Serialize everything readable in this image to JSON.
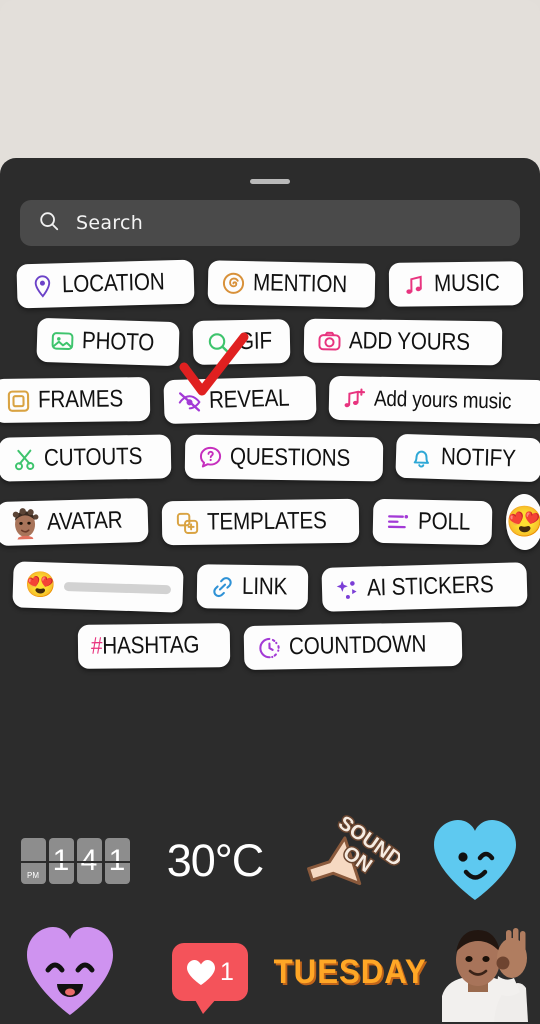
{
  "app": {
    "name": "Instagram Stories sticker tray"
  },
  "search": {
    "placeholder": "Search",
    "value": "",
    "icon": "search-icon"
  },
  "tray": {
    "grabber": "drag-handle",
    "rows": [
      {
        "items": [
          {
            "label": "LOCATION",
            "icon": "location-pin-icon",
            "color": "#6b42c8",
            "style": "caps",
            "rot": "r-1"
          },
          {
            "label": "MENTION",
            "icon": "threads-at-icon",
            "color": "#d8913a",
            "style": "caps",
            "rot": "r-2"
          },
          {
            "label": "MUSIC",
            "icon": "music-note-icon",
            "color": "#e8347f",
            "style": "caps",
            "rot": "r-3"
          }
        ]
      },
      {
        "items": [
          {
            "label": "PHOTO",
            "icon": "photo-image-icon",
            "color": "#3ec46d",
            "style": "caps",
            "rot": "r-4"
          },
          {
            "label": "GIF",
            "icon": "gif-search-icon",
            "color": "#3ec46d",
            "style": "caps",
            "rot": "r-5"
          },
          {
            "label": "ADD YOURS",
            "icon": "camera-icon",
            "color": "#e8347f",
            "style": "caps",
            "rot": "r-6"
          }
        ]
      },
      {
        "items": [
          {
            "label": "FRAMES",
            "icon": "frame-square-icon",
            "color": "#d9a342",
            "style": "caps",
            "rot": "r-3"
          },
          {
            "label": "REVEAL",
            "icon": "eye-slash-icon",
            "color": "#a33ad6",
            "style": "caps",
            "rot": "r-1"
          },
          {
            "label": "Add yours music",
            "icon": "music-note-plus-icon",
            "color": "#e8347f",
            "style": "mixed",
            "rot": "r-2"
          }
        ]
      },
      {
        "items": [
          {
            "label": "CUTOUTS",
            "icon": "scissors-icon",
            "color": "#3ec46d",
            "style": "caps",
            "rot": "r-5"
          },
          {
            "label": "QUESTIONS",
            "icon": "question-bubble-icon",
            "color": "#c62fbe",
            "style": "caps",
            "rot": "r-6"
          },
          {
            "label": "NOTIFY",
            "icon": "bell-icon",
            "color": "#2fa8d6",
            "style": "caps",
            "rot": "r-4"
          }
        ]
      },
      {
        "items": [
          {
            "label": "AVATAR",
            "icon": "avatar-face-icon",
            "color": "#8d5a44",
            "style": "caps",
            "rot": "r-1"
          },
          {
            "label": "TEMPLATES",
            "icon": "templates-plus-icon",
            "color": "#d9a342",
            "style": "caps",
            "rot": "r-3"
          },
          {
            "label": "POLL",
            "icon": "poll-bars-icon",
            "color": "#a33ad6",
            "style": "caps",
            "rot": "r-2"
          },
          {
            "label": "",
            "icon": "heart-eyes-emoji",
            "emoji": "😍",
            "style": "emoji-round",
            "rot": "r-5"
          }
        ]
      },
      {
        "items": [
          {
            "label": "",
            "icon": "emoji-slider-icon",
            "emoji": "😍",
            "style": "emoji-slider",
            "rot": "r-4"
          },
          {
            "label": "LINK",
            "icon": "link-chain-icon",
            "color": "#2f92d6",
            "style": "caps",
            "rot": "r-6"
          },
          {
            "label": "AI STICKERS",
            "icon": "ai-sparkle-icon",
            "color": "#7b3ed6",
            "style": "caps",
            "rot": "r-1"
          }
        ]
      },
      {
        "items": [
          {
            "label": "#HASHTAG",
            "icon": "hashtag-icon",
            "color": "#e8347f",
            "style": "hashtag",
            "rot": "r-3"
          },
          {
            "label": "COUNTDOWN",
            "icon": "countdown-timer-icon",
            "color": "#a33ad6",
            "style": "caps",
            "rot": "r-5"
          }
        ]
      }
    ]
  },
  "free_stickers": {
    "clock": {
      "name": "flip-clock-sticker",
      "ampm": "PM",
      "digits": [
        "1",
        "4",
        "1"
      ]
    },
    "temperature": {
      "name": "temperature-sticker",
      "value": "30°C"
    },
    "sound_on": {
      "name": "sound-on-sticker",
      "line1": "SOUND",
      "line2": "ON"
    },
    "blue_heart": {
      "name": "blue-winking-heart-sticker"
    },
    "purple_heart": {
      "name": "purple-smiling-heart-sticker"
    },
    "like": {
      "name": "like-count-sticker",
      "count": "1"
    },
    "tuesday": {
      "name": "tuesday-sticker",
      "label": "TUESDAY"
    },
    "avatar_wave": {
      "name": "avatar-waving-sticker"
    }
  },
  "annotation": {
    "name": "red-check-annotation",
    "color": "#e02020",
    "target": "PHOTO"
  },
  "colors": {
    "tray_bg": "#2c2c2c",
    "story_bg": "#e3dfda",
    "pill_bg": "#fdfdfd",
    "search_bg": "#4a4a4a",
    "text_dark": "#111111"
  }
}
